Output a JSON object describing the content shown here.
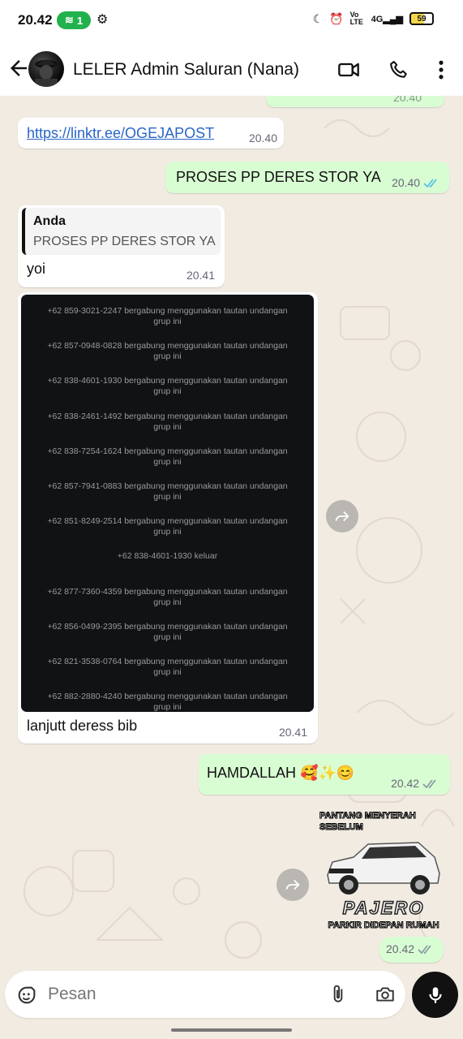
{
  "status": {
    "time": "20.42",
    "pill": "1",
    "battery": "59",
    "network": "4G",
    "volte": "Vo LTE"
  },
  "header": {
    "title": "LELER Admin Saluran (Nana)"
  },
  "messages": {
    "m0_time": "20.40",
    "m1_link": "https://linktr.ee/OGEJAPOST",
    "m1_time": "20.40",
    "m2_text": "PROSES PP DERES STOR YA",
    "m2_time": "20.40",
    "m3_quote_author": "Anda",
    "m3_quote_text": "PROSES PP DERES STOR YA",
    "m3_text": "yoi",
    "m3_time": "20.41",
    "m4_caption": "lanjutt deress bib",
    "m4_time": "20.41",
    "m4_screenshot_lines": [
      "+62 859-3021-2247 bergabung menggunakan tautan undangan|grup ini",
      "+62 857-0948-0828 bergabung menggunakan tautan undangan|grup ini",
      "+62 838-4601-1930 bergabung menggunakan tautan undangan|grup ini",
      "+62 838-2461-1492 bergabung menggunakan tautan undangan|grup ini",
      "+62 838-7254-1624 bergabung menggunakan tautan undangan|grup ini",
      "+62 857-7941-0883 bergabung menggunakan tautan undangan|grup ini",
      "+62 851-8249-2514 bergabung menggunakan tautan undangan|grup ini",
      "+62 838-4601-1930 keluar",
      "+62 877-7360-4359 bergabung menggunakan tautan undangan|grup ini",
      "+62 856-0499-2395 bergabung menggunakan tautan undangan|grup ini",
      "+62 821-3538-0764 bergabung menggunakan tautan undangan|grup ini",
      "+62 882-2880-4240 bergabung menggunakan tautan undangan|grup ini"
    ],
    "m5_text": "HAMDALLAH 🥰✨😊",
    "m5_time": "20.42",
    "m6_sticker_top": "PANTANG MENYERAH SEBELUM",
    "m6_sticker_brand": "PAJERO",
    "m6_sticker_bottom": "PARKIR DIDEPAN RUMAH",
    "m6_time": "20.42"
  },
  "input": {
    "placeholder": "Pesan"
  },
  "colors": {
    "outgoing": "#d9fdd3",
    "incoming": "#ffffff",
    "read_tick": "#53bdeb",
    "sent_tick": "#8696a0",
    "chat_bg": "#f1ebe2"
  }
}
